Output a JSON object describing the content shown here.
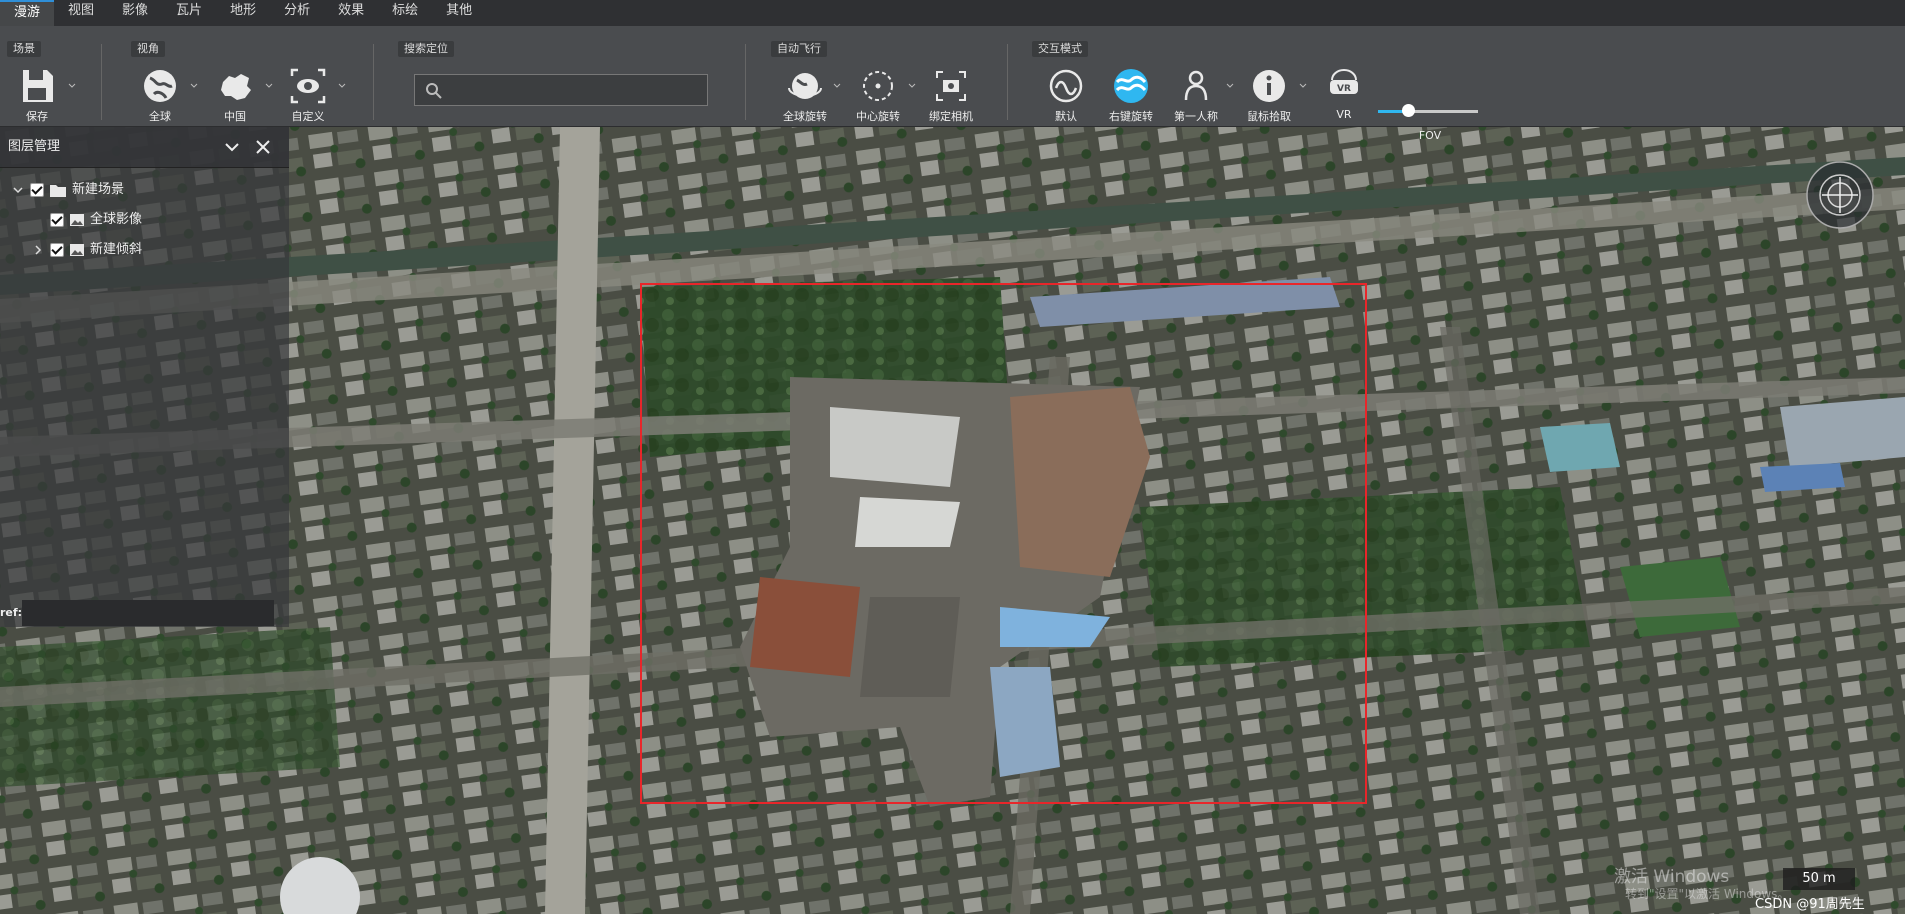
{
  "menu": {
    "tabs": [
      "漫游",
      "视图",
      "影像",
      "瓦片",
      "地形",
      "分析",
      "效果",
      "标绘",
      "其他"
    ],
    "active_index": 0
  },
  "ribbon": {
    "groups": {
      "scene": "场景",
      "view": "视角",
      "search": "搜索定位",
      "autofly": "自动飞行",
      "interaction": "交互模式"
    },
    "tools": {
      "save": "保存",
      "globe": "全球",
      "china": "中国",
      "custom": "自定义",
      "globe_rotate": "全球旋转",
      "center_rotate": "中心旋转",
      "bind_camera": "绑定相机",
      "default": "默认",
      "right_rotate": "右键旋转",
      "first_person": "第一人称",
      "mouse_pick": "鼠标拾取",
      "vr": "VR",
      "fov": "FOV"
    },
    "search_value": "",
    "fov_level": 0.3,
    "accent": "#2fb7f0"
  },
  "layer_panel": {
    "title": "图层管理",
    "tree": {
      "root": {
        "label": "新建场景",
        "checked": true,
        "expanded": true
      },
      "children": [
        {
          "label": "全球影像",
          "checked": true
        },
        {
          "label": "新建倾斜",
          "checked": true,
          "expanded": false
        }
      ]
    },
    "ref_label": "ref:",
    "ref_value": ""
  },
  "map": {
    "scale_label": "50 m",
    "highlight_color": "#e8262a",
    "watermark_line1": "激活 Windows",
    "watermark_line2": "转到\"设置\"以激活 Windows。",
    "credit": "CSDN @91周先生"
  }
}
